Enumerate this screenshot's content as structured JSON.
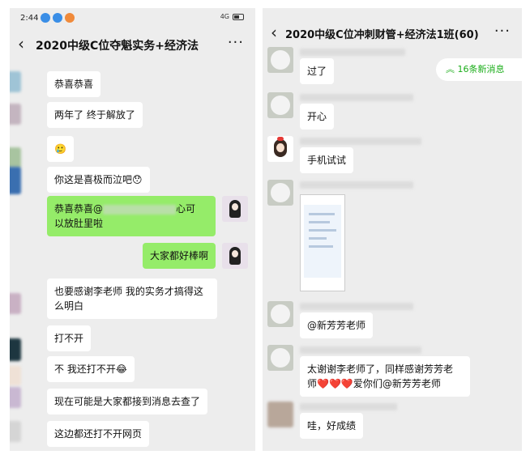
{
  "left": {
    "status": {
      "time": "2:44",
      "signal": "4G"
    },
    "title": "2020中级C位夺魁实务+经济法",
    "back_icon": "chevron-left-icon",
    "more_icon": "more-icon",
    "messages": [
      {
        "text": "恭喜恭喜"
      },
      {
        "text": "两年了 终于解放了"
      },
      {
        "text": "🥲"
      },
      {
        "text": "你这是喜极而泣吧😯"
      },
      {
        "text_a": "恭喜恭喜@",
        "text_b": "心可",
        "text_c": "以放肚里啦"
      },
      {
        "text": "大家都好棒啊"
      },
      {
        "text_a": "也要感谢李老师 我的实务才搞得这",
        "text_b": "么明白"
      },
      {
        "text": "打不开"
      },
      {
        "text": "不 我还打不开😂"
      },
      {
        "text": "现在可能是大家都接到消息去查了"
      },
      {
        "text": "这边都还打不开网页"
      }
    ]
  },
  "right": {
    "title": "2020中级C位冲刺财管+经济法1班(60)",
    "new_messages": "16条新消息",
    "back_icon": "chevron-left-icon",
    "more_icon": "more-icon",
    "messages": [
      {
        "text": "过了"
      },
      {
        "text": "开心"
      },
      {
        "text": "手机试试"
      },
      {
        "text": "@新芳芳老师"
      },
      {
        "text_a": "太谢谢李老师了，同样感谢芳芳老",
        "text_b": "师❤️❤️❤️爱你们@新芳芳老师"
      },
      {
        "text": "哇，好成绩"
      }
    ]
  }
}
